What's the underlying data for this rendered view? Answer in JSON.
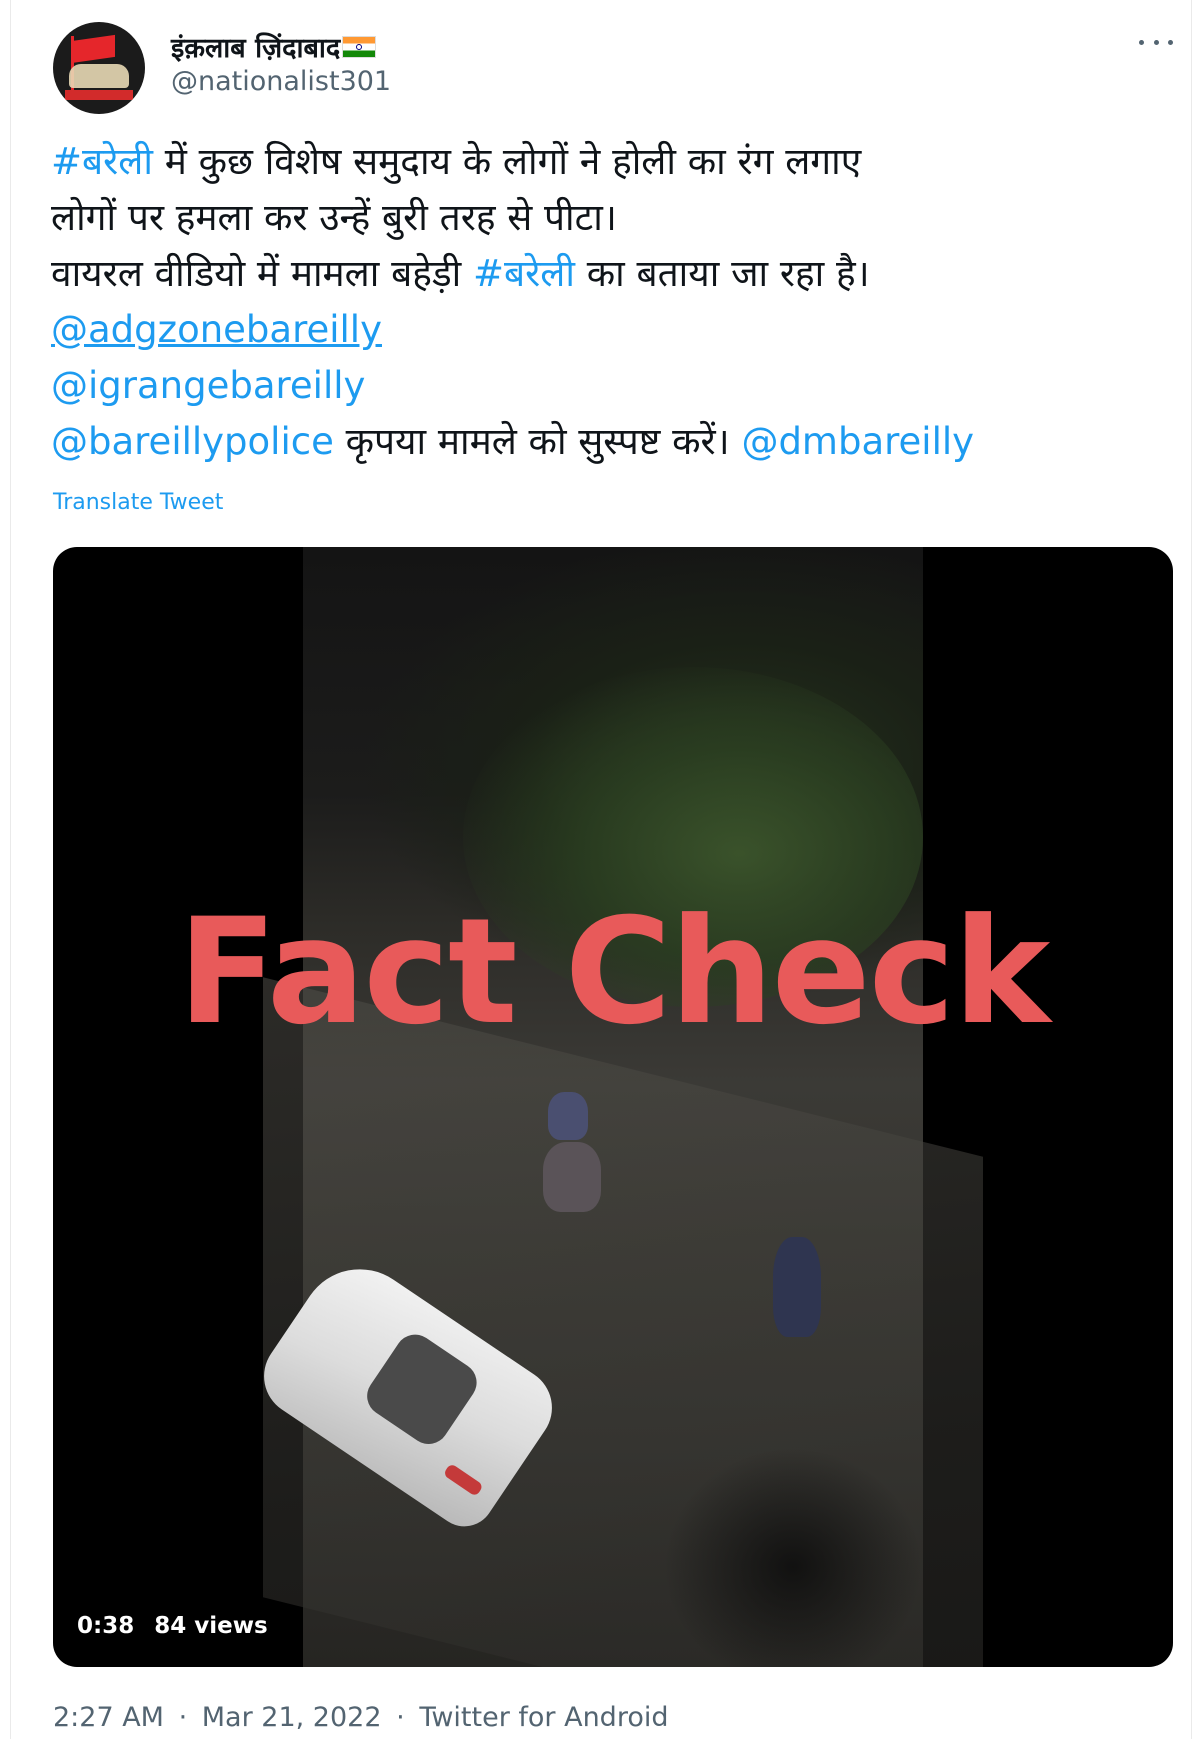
{
  "author": {
    "display_name": "इंक़लाब ज़िंदाबाद",
    "flag_icon": "india-flag-icon",
    "handle": "@nationalist301",
    "avatar_icon": "red-flag-crowd-avatar-icon"
  },
  "menu_icon": "more-horizontal-icon",
  "tweet": {
    "line1_hashtag": "#बरेली",
    "line1_rest": " में कुछ विशेष समुदाय के लोगों ने होली का रंग लगाए",
    "line2": "लोगों पर हमला कर उन्हें बुरी तरह से पीटा।",
    "line3_pre": "वायरल वीडियो में मामला बहेड़ी ",
    "line3_hashtag": "#बरेली",
    "line3_post": " का बताया जा रहा है।",
    "mention1": "@adgzonebareilly",
    "mention2": "@igrangebareilly",
    "mention3": "@bareillypolice",
    "line6_mid": " कृपया मामले को सुस्पष्ट करें। ",
    "mention4": "@dmbareilly"
  },
  "translate_label": "Translate Tweet",
  "video": {
    "watermark": "Fact Check",
    "duration": "0:38",
    "views": "84 views"
  },
  "footer": {
    "time": "2:27 AM",
    "separator": "·",
    "date": "Mar 21, 2022",
    "app": "Twitter for Android"
  },
  "colors": {
    "link": "#1d9bf0",
    "watermark": "#e85a5a",
    "secondary_text": "#536471"
  }
}
